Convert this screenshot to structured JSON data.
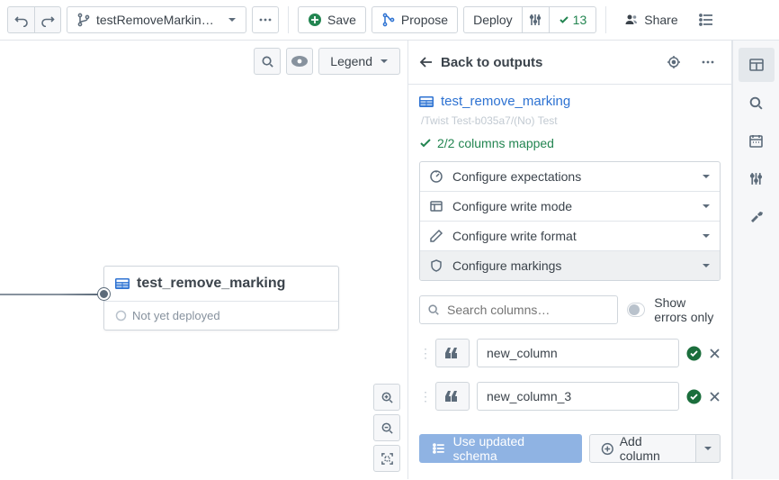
{
  "topbar": {
    "branch": "testRemoveMarkin…",
    "save": "Save",
    "propose": "Propose",
    "deploy": "Deploy",
    "deploy_count": "13",
    "share": "Share"
  },
  "canvas": {
    "legend": "Legend",
    "node_name": "test_remove_marking",
    "node_status": "Not yet deployed"
  },
  "panel": {
    "back": "Back to outputs",
    "dataset": "test_remove_marking",
    "breadcrumb": "/Twist Test-b035a7/(No) Test",
    "mapped": "2/2 columns mapped",
    "config": [
      "Configure expectations",
      "Configure write mode",
      "Configure write format",
      "Configure markings"
    ],
    "search_placeholder": "Search columns…",
    "errors_label": "Show errors only",
    "columns": [
      "new_column",
      "new_column_3"
    ],
    "use_updated": "Use updated schema",
    "add_col": "Add column"
  }
}
